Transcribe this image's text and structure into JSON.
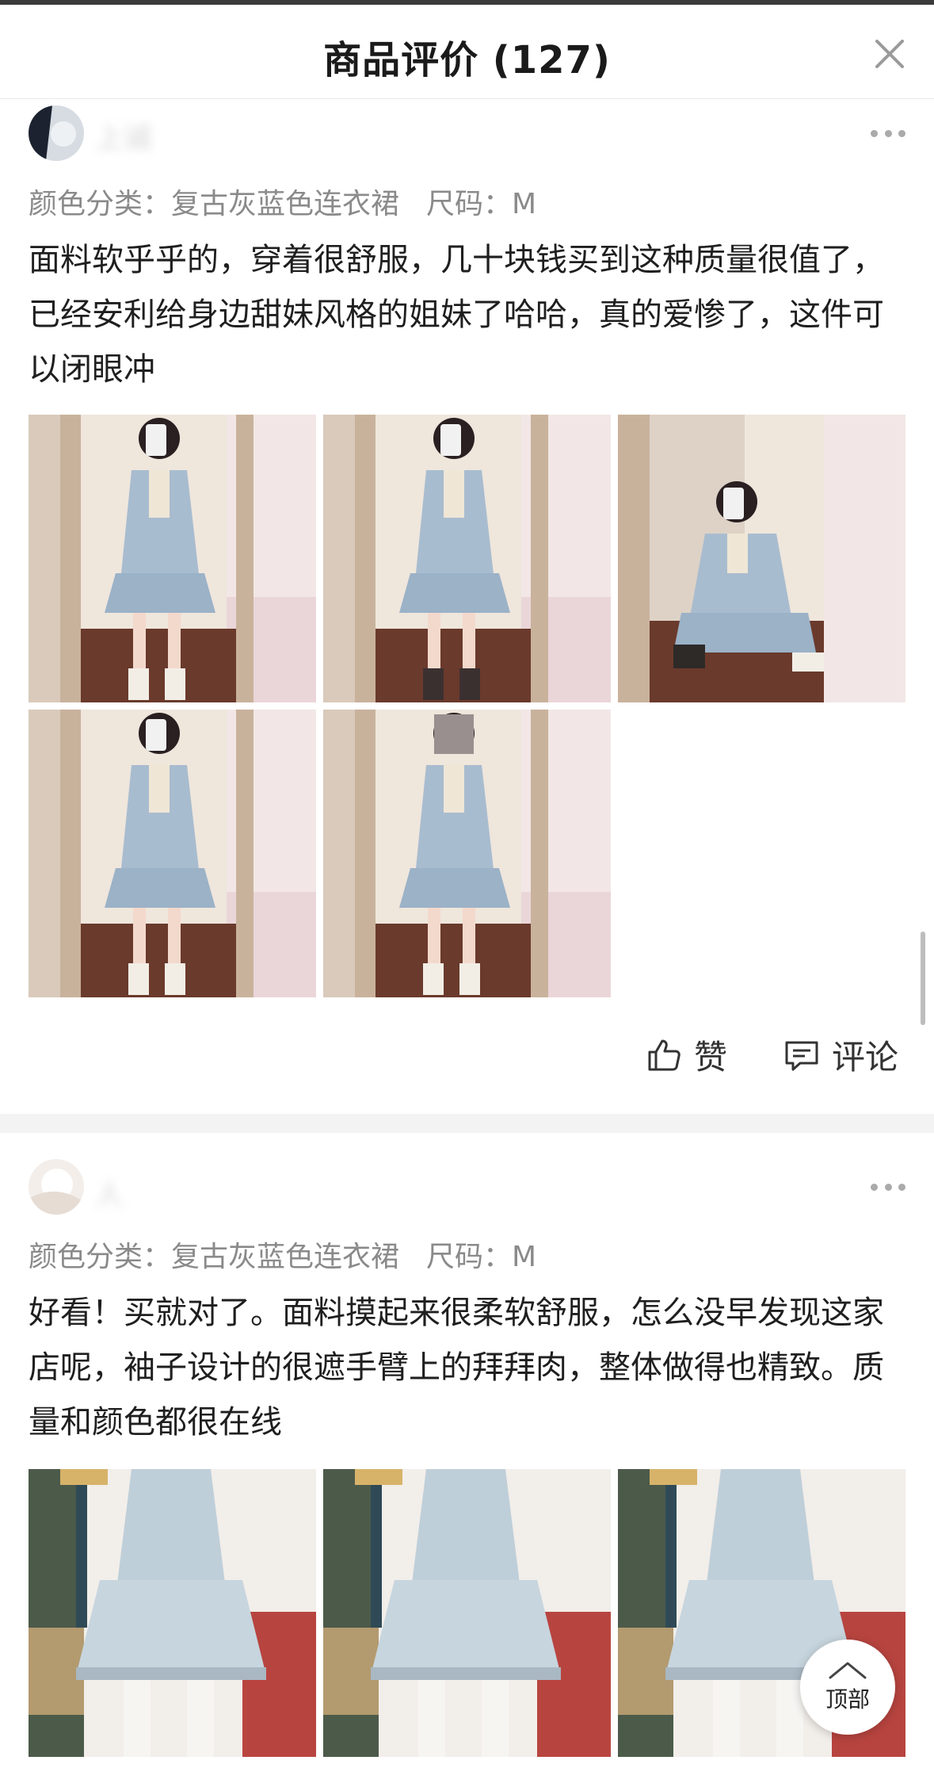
{
  "header": {
    "title": "商品评价 (127)"
  },
  "reviews": [
    {
      "user_name": "上诚",
      "spec_color": "颜色分类：复古灰蓝色连衣裙",
      "spec_size": "尺码：M",
      "text": "面料软乎乎的，穿着很舒服，几十块钱买到这种质量很值了，已经安利给身边甜妹风格的姐妹了哈哈，真的爱惨了，这件可以闭眼冲",
      "like_label": "赞",
      "comment_label": "评论"
    },
    {
      "user_name": "人",
      "spec_color": "颜色分类：复古灰蓝色连衣裙",
      "spec_size": "尺码：M",
      "text": "好看！买就对了。面料摸起来很柔软舒服，怎么没早发现这家店呢，袖子设计的很遮手臂上的拜拜肉，整体做得也精致。质量和颜色都很在线"
    }
  ],
  "back_to_top": {
    "label": "顶部"
  },
  "colors": {
    "divider": "#f3f3f3",
    "spec_text": "#8a8a8a",
    "body_text": "#1f1f1f"
  }
}
